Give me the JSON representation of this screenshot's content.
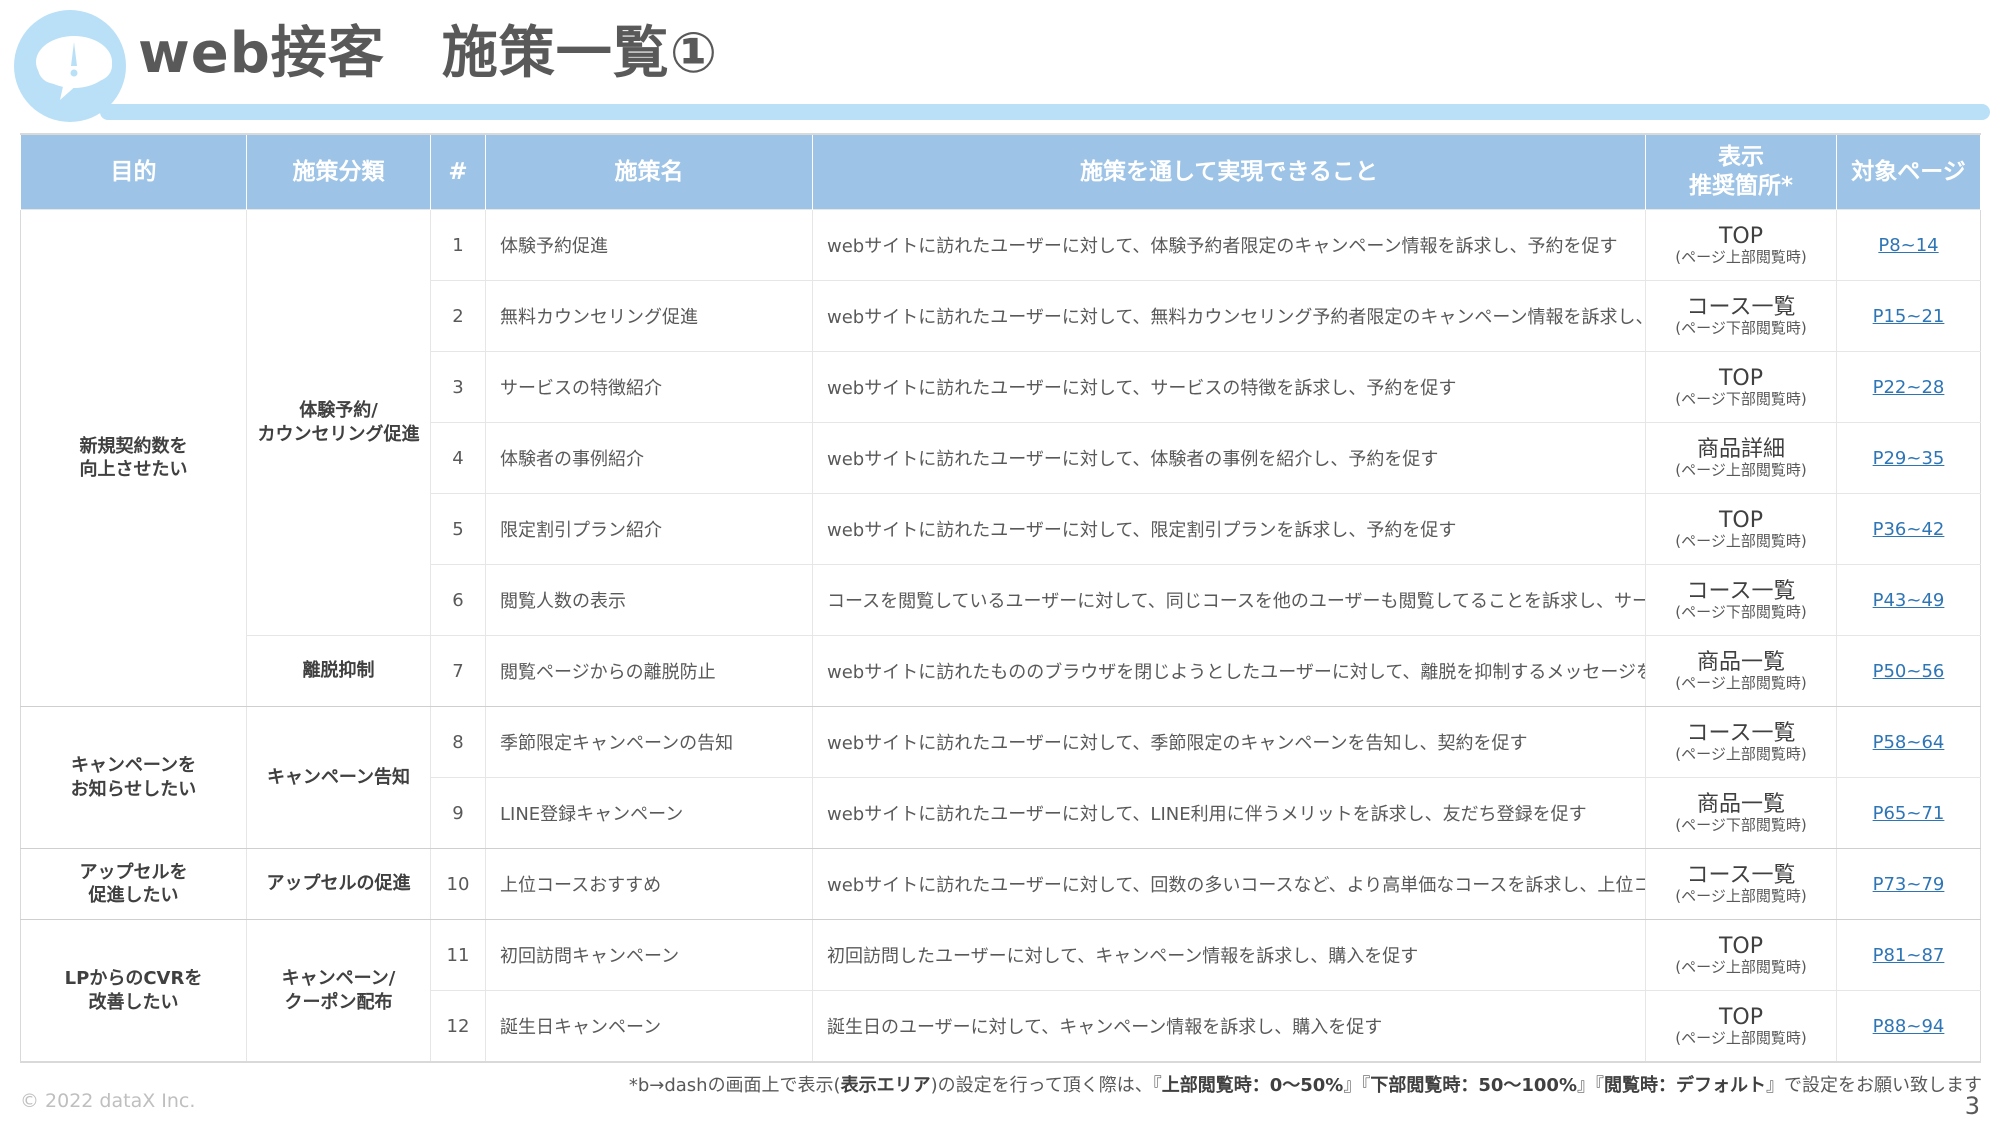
{
  "title": "web接客　施策一覧①",
  "icon": "speech-bubble-exclamation-icon",
  "colors": {
    "header_bg": "#9dc3e6",
    "accent_bar": "#b9e0f7",
    "link": "#2e75b6"
  },
  "table": {
    "headers": {
      "purpose": "目的",
      "category": "施策分類",
      "num": "#",
      "name": "施策名",
      "description": "施策を通して実現できること",
      "location_line1": "表示",
      "location_line2": "推奨箇所*",
      "pages": "対象ページ"
    },
    "purposes": [
      {
        "line1": "新規契約数を",
        "line2": "向上させたい"
      },
      {
        "line1": "キャンペーンを",
        "line2": "お知らせしたい"
      },
      {
        "line1": "アップセルを",
        "line2": "促進したい"
      },
      {
        "line1": "LPからのCVRを",
        "line2": "改善したい"
      }
    ],
    "categories": [
      {
        "line1": "体験予約/",
        "line2": "カウンセリング促進"
      },
      {
        "line1": "離脱抑制",
        "line2": ""
      },
      {
        "line1": "キャンペーン告知",
        "line2": ""
      },
      {
        "line1": "アップセルの促進",
        "line2": ""
      },
      {
        "line1": "キャンペーン/",
        "line2": "クーポン配布"
      }
    ],
    "rows": [
      {
        "num": "1",
        "name": "体験予約促進",
        "description": "webサイトに訪れたユーザーに対して、体験予約者限定のキャンペーン情報を訴求し、予約を促す",
        "location": "TOP",
        "location_note": "(ページ上部閲覧時)",
        "pages": "P8~14"
      },
      {
        "num": "2",
        "name": "無料カウンセリング促進",
        "description": "webサイトに訪れたユーザーに対して、無料カウンセリング予約者限定のキャンペーン情報を訴求し、予約を促す",
        "location": "コース一覧",
        "location_note": "(ページ下部閲覧時)",
        "pages": "P15~21"
      },
      {
        "num": "3",
        "name": "サービスの特徴紹介",
        "description": "webサイトに訪れたユーザーに対して、サービスの特徴を訴求し、予約を促す",
        "location": "TOP",
        "location_note": "(ページ下部閲覧時)",
        "pages": "P22~28"
      },
      {
        "num": "4",
        "name": "体験者の事例紹介",
        "description": "webサイトに訪れたユーザーに対して、体験者の事例を紹介し、予約を促す",
        "location": "商品詳細",
        "location_note": "(ページ上部閲覧時)",
        "pages": "P29~35"
      },
      {
        "num": "5",
        "name": "限定割引プラン紹介",
        "description": "webサイトに訪れたユーザーに対して、限定割引プランを訴求し、予約を促す",
        "location": "TOP",
        "location_note": "(ページ上部閲覧時)",
        "pages": "P36~42"
      },
      {
        "num": "6",
        "name": "閲覧人数の表示",
        "description": "コースを閲覧しているユーザーに対して、同じコースを他のユーザーも閲覧してることを訴求し、サービス利用を促す",
        "location": "コース一覧",
        "location_note": "(ページ下部閲覧時)",
        "pages": "P43~49"
      },
      {
        "num": "7",
        "name": "閲覧ページからの離脱防止",
        "description": "webサイトに訪れたもののブラウザを閉じようとしたユーザーに対して、離脱を抑制するメッセージを訴求し、離脱防止を促す",
        "location": "商品一覧",
        "location_note": "(ページ上部閲覧時)",
        "pages": "P50~56"
      },
      {
        "num": "8",
        "name": "季節限定キャンペーンの告知",
        "description": "webサイトに訪れたユーザーに対して、季節限定のキャンペーンを告知し、契約を促す",
        "location": "コース一覧",
        "location_note": "(ページ上部閲覧時)",
        "pages": "P58~64"
      },
      {
        "num": "9",
        "name": "LINE登録キャンペーン",
        "description": "webサイトに訪れたユーザーに対して、LINE利用に伴うメリットを訴求し、友だち登録を促す",
        "location": "商品一覧",
        "location_note": "(ページ下部閲覧時)",
        "pages": "P65~71"
      },
      {
        "num": "10",
        "name": "上位コースおすすめ",
        "description": "webサイトに訪れたユーザーに対して、回数の多いコースなど、より高単価なコースを訴求し、上位コースの契約を促す",
        "location": "コース一覧",
        "location_note": "(ページ上部閲覧時)",
        "pages": "P73~79"
      },
      {
        "num": "11",
        "name": "初回訪問キャンペーン",
        "description": "初回訪問したユーザーに対して、キャンペーン情報を訴求し、購入を促す",
        "location": "TOP",
        "location_note": "(ページ上部閲覧時)",
        "pages": "P81~87"
      },
      {
        "num": "12",
        "name": "誕生日キャンペーン",
        "description": "誕生日のユーザーに対して、キャンペーン情報を訴求し、購入を促す",
        "location": "TOP",
        "location_note": "(ページ上部閲覧時)",
        "pages": "P88~94"
      }
    ]
  },
  "footnote": {
    "part1": "*b→dashの画面上で表示(",
    "bold1": "表示エリア",
    "part2": ")の設定を行って頂く際は、『",
    "bold2": "上部閲覧時：0～50%",
    "part3": "』『",
    "bold3": "下部閲覧時：50～100%",
    "part4": "』『",
    "bold4": "閲覧時：デフォルト",
    "part5": "』で設定をお願い致します"
  },
  "copyright": "© 2022 dataX Inc.",
  "page_number": "3"
}
